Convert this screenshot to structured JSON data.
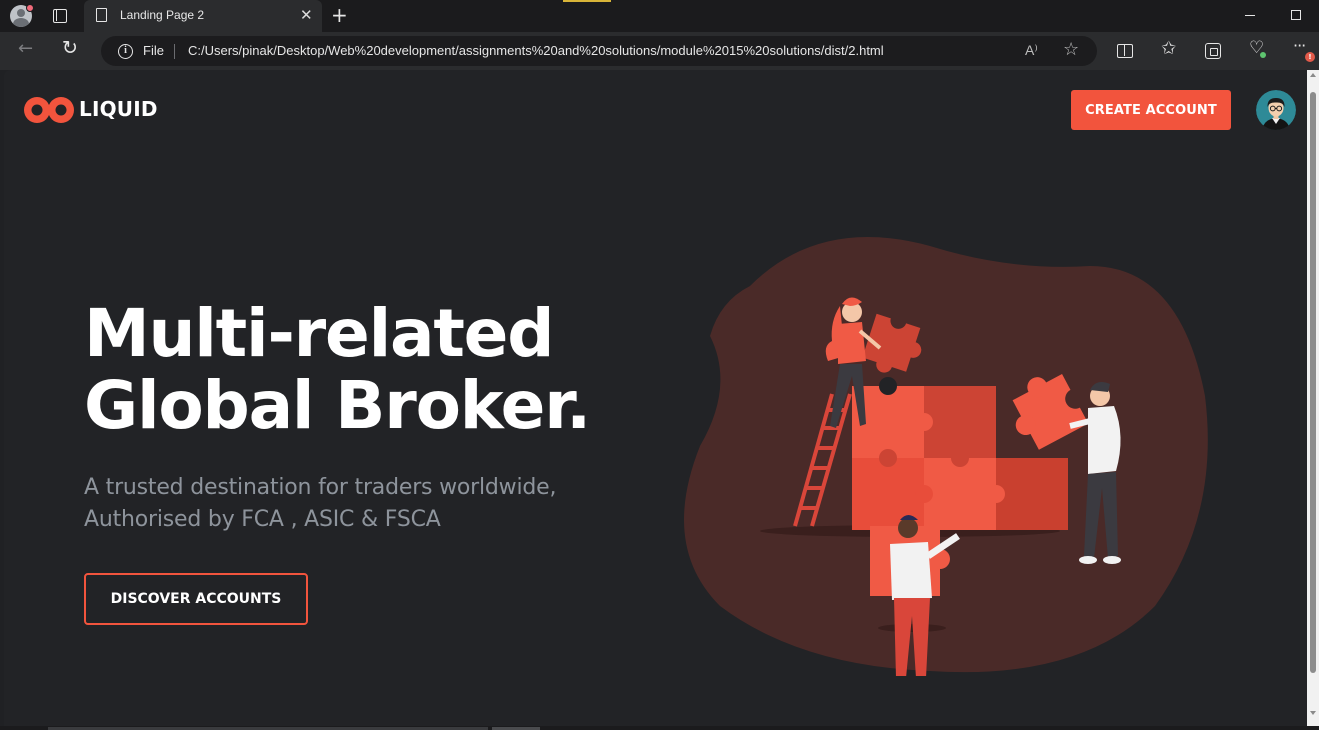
{
  "browser": {
    "tab_title": "Landing Page 2",
    "tab_close": "✕",
    "new_tab": "+",
    "address_scheme": "File",
    "url": "C:/Users/pinak/Desktop/Web%20development/assignments%20and%20solutions/module%2015%20solutions/dist/2.html",
    "read_aloud": "A⁾",
    "more_badge": "!"
  },
  "header": {
    "logo_text": "LIQUID",
    "create_account_label": "CREATE ACCOUNT"
  },
  "hero": {
    "headline_line1": "Multi-related",
    "headline_line2": "Global Broker.",
    "subtext_line1": "A trusted destination for traders worldwide,",
    "subtext_line2": "Authorised by FCA , ASIC & FSCA",
    "discover_label": "DISCOVER ACCOUNTS"
  },
  "colors": {
    "accent": "#f2543d",
    "page_background": "#222326",
    "blob": "#4a2a28",
    "subtext": "#8e949c"
  },
  "icons": {
    "logo": "infinity-logo-icon",
    "avatar": "user-avatar-icon",
    "illustration": "puzzle-team-illustration"
  }
}
